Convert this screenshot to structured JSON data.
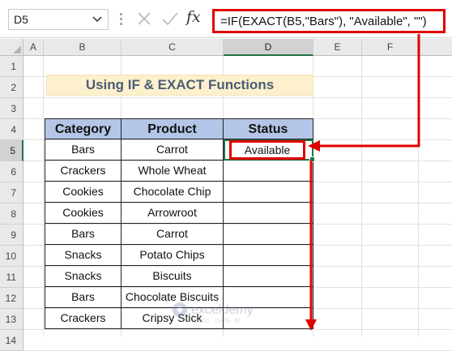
{
  "formula_bar": {
    "name_box": "D5",
    "cancel_icon": "x-icon",
    "enter_icon": "check-icon",
    "function_icon": "fx-icon",
    "function_label": "fx",
    "formula": "=IF(EXACT(B5,\"Bars\"), \"Available\", \"\")"
  },
  "columns": [
    "A",
    "B",
    "C",
    "D",
    "E",
    "F"
  ],
  "rows": [
    "1",
    "2",
    "3",
    "4",
    "5",
    "6",
    "7",
    "8",
    "9",
    "10",
    "11",
    "12",
    "13",
    "14"
  ],
  "selected_column": "D",
  "selected_row": "5",
  "title": "Using IF & EXACT Functions",
  "table": {
    "headers": [
      "Category",
      "Product",
      "Status"
    ],
    "rows": [
      [
        "Bars",
        "Carrot",
        "Available"
      ],
      [
        "Crackers",
        "Whole Wheat",
        ""
      ],
      [
        "Cookies",
        "Chocolate Chip",
        ""
      ],
      [
        "Cookies",
        "Arrowroot",
        ""
      ],
      [
        "Bars",
        "Carrot",
        ""
      ],
      [
        "Snacks",
        "Potato Chips",
        ""
      ],
      [
        "Snacks",
        "Biscuits",
        ""
      ],
      [
        "Bars",
        "Chocolate Biscuits",
        ""
      ],
      [
        "Crackers",
        "Cripsy Stick",
        ""
      ]
    ]
  },
  "watermark": {
    "brand": "exceldemy",
    "tagline": "EXCEL · DATA · BI"
  },
  "colors": {
    "header_fill": "#b4c6e7",
    "title_fill": "#fdf0cc",
    "title_text": "#4a5d78",
    "highlight": "#e00000",
    "selection": "#217346"
  }
}
